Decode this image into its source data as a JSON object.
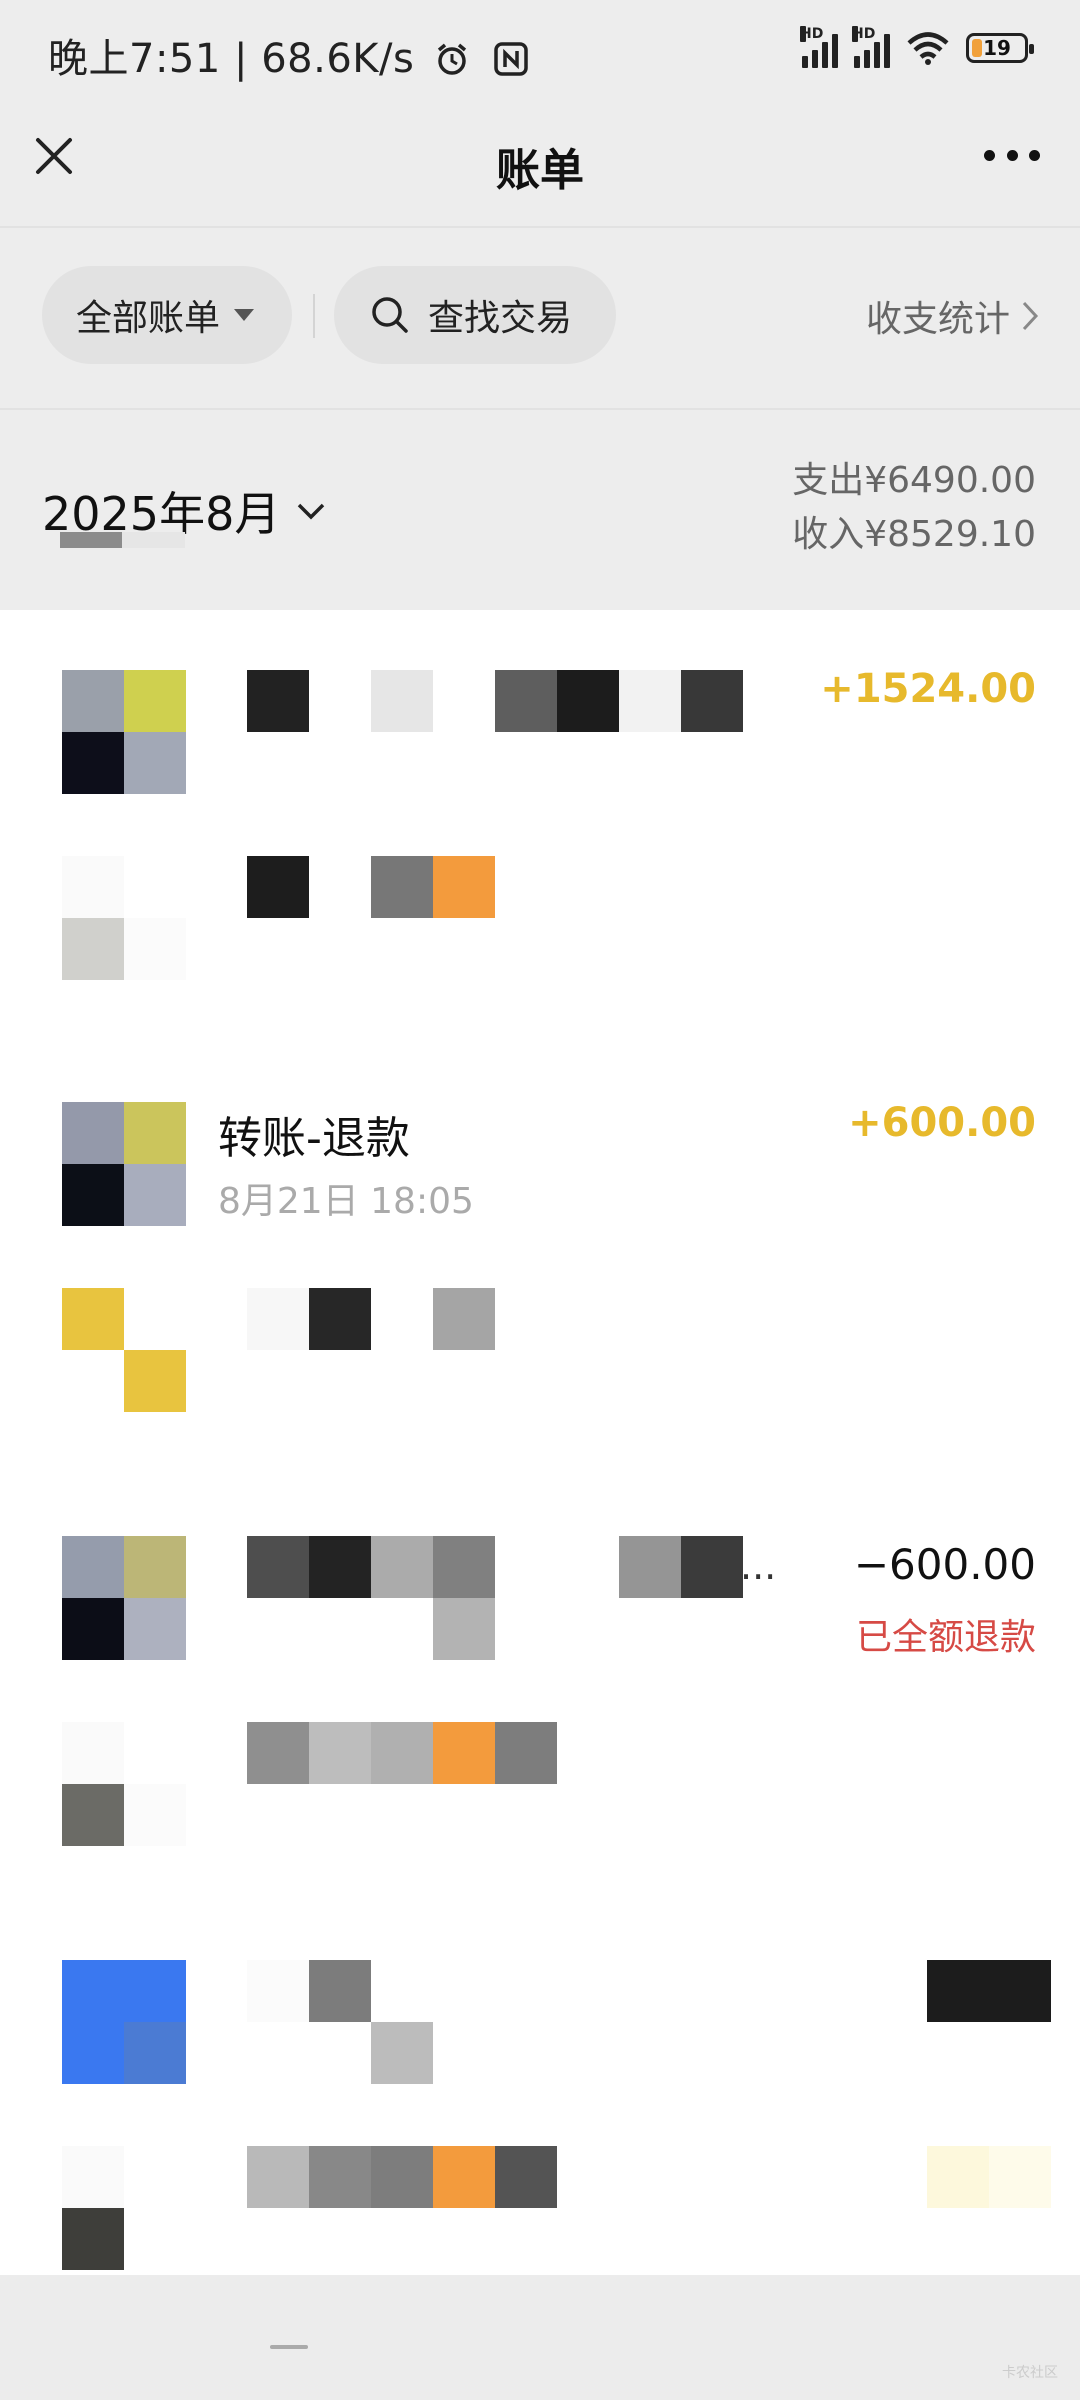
{
  "status_bar": {
    "time_speed": "晚上7:51 | 68.6K/s",
    "hd1": "HD",
    "hd2": "HD",
    "battery": "19",
    "icons": [
      "alarm-icon",
      "nfc-icon",
      "signal-icon",
      "signal-icon",
      "wifi-icon",
      "battery-icon"
    ]
  },
  "nav": {
    "title": "账单",
    "close_icon": "close-icon",
    "more_icon": "more-icon"
  },
  "filters": {
    "all_bills": "全部账单",
    "search": "查找交易",
    "stats": "收支统计"
  },
  "month": {
    "label": "2025年8月",
    "expense": "支出¥6490.00",
    "income": "收入¥8529.10"
  },
  "transactions": [
    {
      "amount": "+1524.00",
      "kind": "income"
    },
    {
      "title": "转账-退款",
      "time": "8月21日 18:05",
      "amount": "+600.00",
      "kind": "income"
    },
    {
      "amount": "−600.00",
      "kind": "expense",
      "tag": "已全额退款",
      "ellipsis": "..."
    }
  ],
  "watermark": "卡农社区",
  "colors": {
    "background": "#ededed",
    "income": "#e7b92c",
    "refund": "#d64a45"
  }
}
